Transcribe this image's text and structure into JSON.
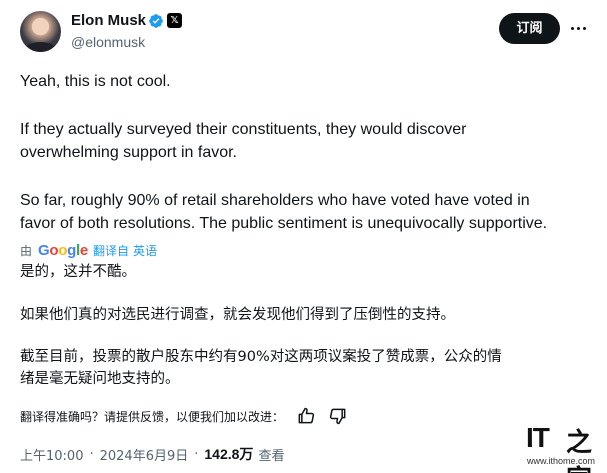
{
  "author": {
    "name": "Elon Musk",
    "handle": "@elonmusk"
  },
  "header": {
    "subscribe_label": "订阅"
  },
  "tweet": {
    "en_paragraphs": [
      "Yeah, this is not cool.",
      "If they actually surveyed their constituents, they would discover",
      "overwhelming support in favor.",
      "So far, roughly 90% of retail shareholders who have voted have voted in",
      "favor of both resolutions. The public sentiment is unequivocally supportive."
    ],
    "zh_paragraphs": [
      "是的，这并不酷。",
      "如果他们真的对选民进行调查，就会发现他们得到了压倒性的支持。",
      "截至目前，投票的散户股东中约有90%对这两项议案投了赞成票，公众的情",
      "绪是毫无疑问地支持的。"
    ]
  },
  "translation": {
    "by": "由",
    "google_letters": [
      "G",
      "o",
      "o",
      "g",
      "l",
      "e"
    ],
    "google_colors": [
      "#4285f4",
      "#ea4335",
      "#fbbc05",
      "#4285f4",
      "#34a853",
      "#ea4335"
    ],
    "translated_from": "翻译自",
    "source_lang": "英语"
  },
  "feedback": {
    "prompt": "翻译得准确吗？请提供反馈，以便我们加以改进："
  },
  "meta": {
    "time": "上午10:00",
    "date": "2024年6月9日",
    "views": "142.8万",
    "views_label": "查看",
    "separator": "·"
  },
  "watermark": {
    "it": "IT",
    "zh": "之家",
    "url": "www.ithome.com"
  },
  "colors": {
    "verified_blue": "#1d9bf0",
    "text": "#0f1419",
    "secondary": "#536471"
  }
}
